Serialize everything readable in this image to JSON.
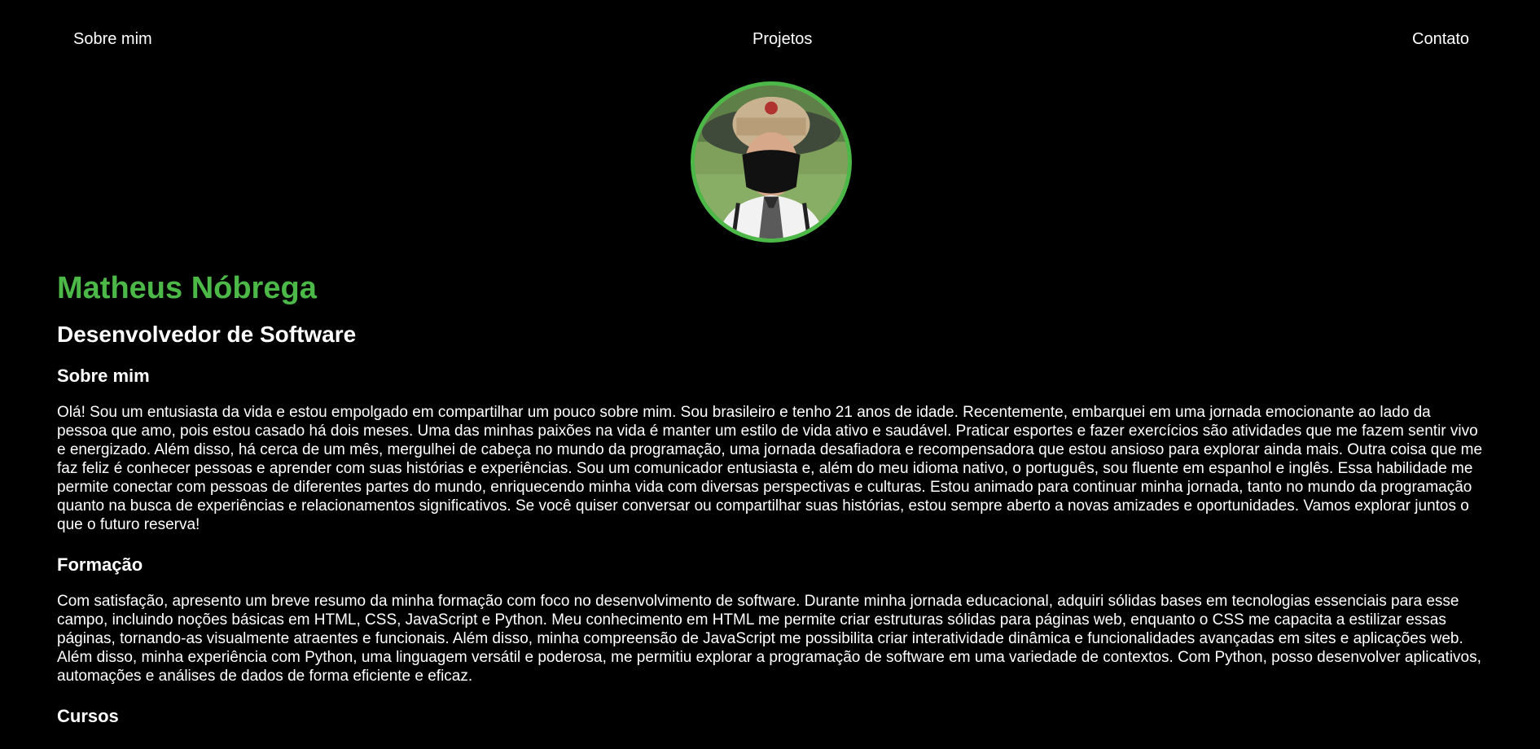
{
  "nav": {
    "about_label": "Sobre mim",
    "projects_label": "Projetos",
    "contact_label": "Contato"
  },
  "profile": {
    "name": "Matheus Nóbrega",
    "role": "Desenvolvedor de Software",
    "accent_color": "#4cb848"
  },
  "sections": {
    "about": {
      "title": "Sobre mim",
      "text": "Olá! Sou um entusiasta da vida e estou empolgado em compartilhar um pouco sobre mim. Sou brasileiro e tenho 21 anos de idade. Recentemente, embarquei em uma jornada emocionante ao lado da pessoa que amo, pois estou casado há dois meses. Uma das minhas paixões na vida é manter um estilo de vida ativo e saudável. Praticar esportes e fazer exercícios são atividades que me fazem sentir vivo e energizado. Além disso, há cerca de um mês, mergulhei de cabeça no mundo da programação, uma jornada desafiadora e recompensadora que estou ansioso para explorar ainda mais. Outra coisa que me faz feliz é conhecer pessoas e aprender com suas histórias e experiências. Sou um comunicador entusiasta e, além do meu idioma nativo, o português, sou fluente em espanhol e inglês. Essa habilidade me permite conectar com pessoas de diferentes partes do mundo, enriquecendo minha vida com diversas perspectivas e culturas. Estou animado para continuar minha jornada, tanto no mundo da programação quanto na busca de experiências e relacionamentos significativos. Se você quiser conversar ou compartilhar suas histórias, estou sempre aberto a novas amizades e oportunidades. Vamos explorar juntos o que o futuro reserva!"
    },
    "education": {
      "title": "Formação",
      "text": "Com satisfação, apresento um breve resumo da minha formação com foco no desenvolvimento de software. Durante minha jornada educacional, adquiri sólidas bases em tecnologias essenciais para esse campo, incluindo noções básicas em HTML, CSS, JavaScript e Python. Meu conhecimento em HTML me permite criar estruturas sólidas para páginas web, enquanto o CSS me capacita a estilizar essas páginas, tornando-as visualmente atraentes e funcionais. Além disso, minha compreensão de JavaScript me possibilita criar interatividade dinâmica e funcionalidades avançadas em sites e aplicações web. Além disso, minha experiência com Python, uma linguagem versátil e poderosa, me permitiu explorar a programação de software em uma variedade de contextos. Com Python, posso desenvolver aplicativos, automações e análises de dados de forma eficiente e eficaz."
    },
    "courses": {
      "title": "Cursos"
    }
  }
}
